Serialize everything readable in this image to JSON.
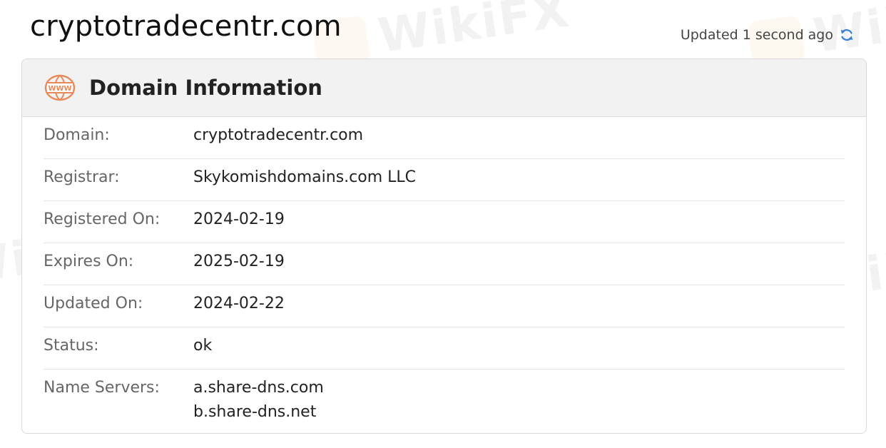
{
  "header": {
    "domain": "cryptotradecentr.com",
    "updated_text": "Updated 1 second ago",
    "refresh_icon": "refresh-icon"
  },
  "card": {
    "icon": "www-globe-icon",
    "title": "Domain Information",
    "rows": [
      {
        "label": "Domain:",
        "value": "cryptotradecentr.com"
      },
      {
        "label": "Registrar:",
        "value": "Skykomishdomains.com LLC"
      },
      {
        "label": "Registered On:",
        "value": "2024-02-19"
      },
      {
        "label": "Expires On:",
        "value": "2025-02-19"
      },
      {
        "label": "Updated On:",
        "value": "2024-02-22"
      },
      {
        "label": "Status:",
        "value": "ok"
      },
      {
        "label": "Name Servers:",
        "values": [
          "a.share-dns.com",
          "b.share-dns.net"
        ]
      }
    ]
  },
  "watermark": {
    "text": "WikiFX"
  },
  "colors": {
    "accent": "#e8895a",
    "refresh": "#3a7fd5"
  }
}
